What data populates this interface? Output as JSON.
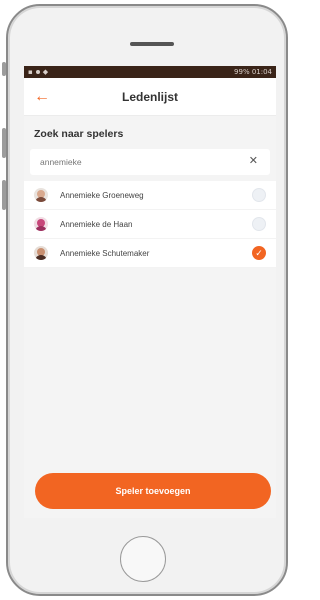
{
  "status_bar": {
    "right_text": "99% 01:04"
  },
  "header": {
    "title": "Ledenlijst"
  },
  "search": {
    "label": "Zoek naar spelers",
    "value": "annemieke"
  },
  "players": [
    {
      "name": "Annemieke Groeneweg",
      "selected": false
    },
    {
      "name": "Annemieke de Haan",
      "selected": false
    },
    {
      "name": "Annemieke Schutemaker",
      "selected": true
    }
  ],
  "action": {
    "add_label": "Speler toevoegen"
  },
  "colors": {
    "accent": "#f26522",
    "statusbar": "#3a2418"
  }
}
